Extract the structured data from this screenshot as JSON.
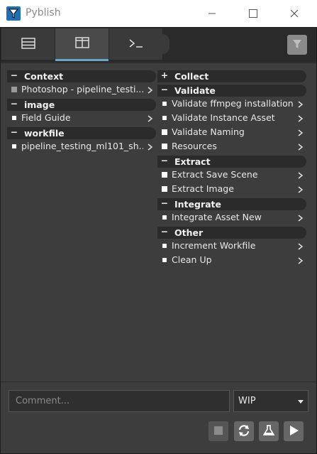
{
  "window": {
    "title": "Pyblish"
  },
  "left_panel": [
    {
      "group": "Context",
      "toggle": "−",
      "items": [
        {
          "label": "Photoshop - pipeline_testi...",
          "check": "grey"
        }
      ]
    },
    {
      "group": "image",
      "toggle": "−",
      "items": [
        {
          "label": "Field Guide",
          "check": "ring"
        }
      ]
    },
    {
      "group": "workfile",
      "toggle": "−",
      "items": [
        {
          "label": "pipeline_testing_ml101_sh...",
          "check": "ring"
        }
      ]
    }
  ],
  "right_panel": [
    {
      "group": "Collect",
      "toggle": "+",
      "items": []
    },
    {
      "group": "Validate",
      "toggle": "−",
      "items": [
        {
          "label": "Validate ffmpeg installation",
          "check": "ring"
        },
        {
          "label": "Validate Instance Asset",
          "check": "ring"
        },
        {
          "label": "Validate Naming",
          "check": "white"
        },
        {
          "label": "Resources",
          "check": "white"
        }
      ]
    },
    {
      "group": "Extract",
      "toggle": "−",
      "items": [
        {
          "label": "Extract Save Scene",
          "check": "white"
        },
        {
          "label": "Extract Image",
          "check": "white"
        }
      ]
    },
    {
      "group": "Integrate",
      "toggle": "−",
      "items": [
        {
          "label": "Integrate Asset New",
          "check": "ring"
        }
      ]
    },
    {
      "group": "Other",
      "toggle": "−",
      "items": [
        {
          "label": "Increment Workfile",
          "check": "ring"
        },
        {
          "label": "Clean Up",
          "check": "ring"
        }
      ]
    }
  ],
  "footer": {
    "comment_placeholder": "Comment...",
    "state_value": "WIP"
  },
  "colors": {
    "accent": "#6ea2c4",
    "tab_active": "#4a4a4a",
    "group_bg": "#2b2b2b"
  }
}
